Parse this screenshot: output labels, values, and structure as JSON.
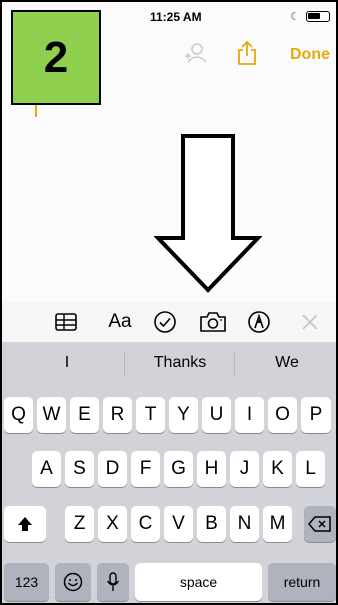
{
  "status_bar": {
    "time": "11:25 AM"
  },
  "step_badge": {
    "label": "2"
  },
  "nav": {
    "done_label": "Done"
  },
  "accent_color": "#e8a80c",
  "badge_color": "#8fd14f",
  "toolbar": {
    "format_label": "Aa",
    "icons": [
      "table-icon",
      "format-text-icon",
      "checklist-icon",
      "camera-icon",
      "markup-icon",
      "close-icon"
    ]
  },
  "keyboard": {
    "suggestions": [
      "I",
      "Thanks",
      "We"
    ],
    "row1": [
      "Q",
      "W",
      "E",
      "R",
      "T",
      "Y",
      "U",
      "I",
      "O",
      "P"
    ],
    "row2": [
      "A",
      "S",
      "D",
      "F",
      "G",
      "H",
      "J",
      "K",
      "L"
    ],
    "row3": [
      "Z",
      "X",
      "C",
      "V",
      "B",
      "N",
      "M"
    ],
    "numbers_label": "123",
    "space_label": "space",
    "return_label": "return"
  }
}
